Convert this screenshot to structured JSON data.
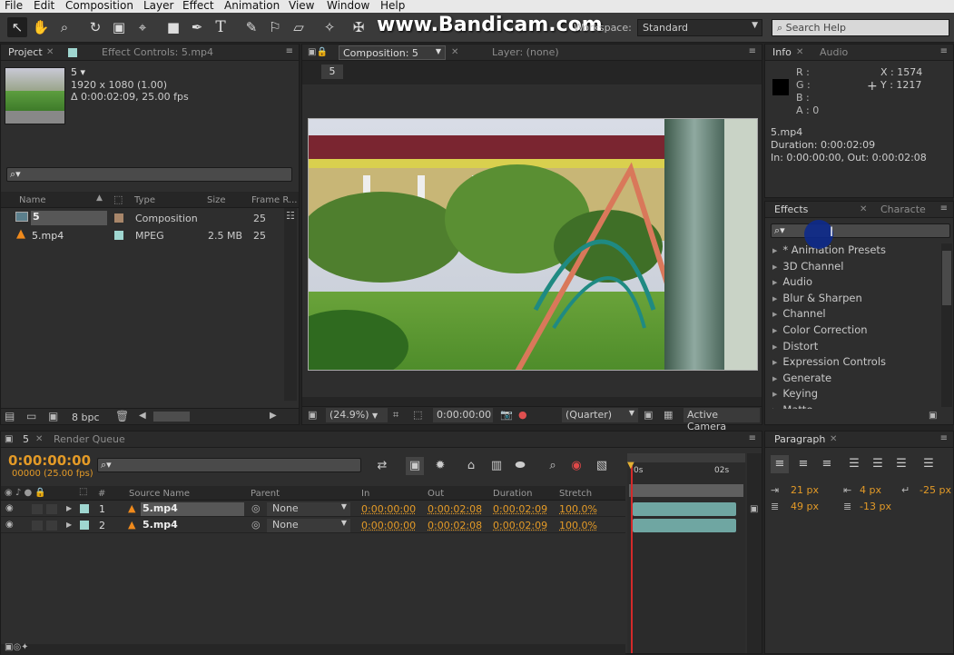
{
  "menu": [
    "File",
    "Edit",
    "Composition",
    "Layer",
    "Effect",
    "Animation",
    "View",
    "Window",
    "Help"
  ],
  "watermark": "www.Bandicam.com",
  "workspace": {
    "label": "Workspace:",
    "value": "Standard",
    "search_placeholder": "Search Help"
  },
  "project": {
    "tab_project": "Project",
    "tab_effect_controls": "Effect Controls: 5.mp4",
    "comp_name": "5 ▾",
    "comp_res": "1920 x 1080 (1.00)",
    "comp_dur": "Δ 0:00:02:09, 25.00 fps",
    "columns": [
      "Name",
      "Type",
      "Size",
      "Frame R..."
    ],
    "items": [
      {
        "name": "5",
        "type": "Composition",
        "size": "",
        "fps": "25",
        "color": "#a8866a"
      },
      {
        "name": "5.mp4",
        "type": "MPEG",
        "size": "2.5 MB",
        "fps": "25",
        "color": "#9fd6d0"
      }
    ],
    "bpc": "8 bpc"
  },
  "composition": {
    "tab_label": "Composition: 5",
    "layer_label": "Layer: (none)",
    "breadcrumb": "5",
    "zoom": "(24.9%)",
    "time": "0:00:00:00",
    "resolution": "(Quarter)",
    "camera": "Active Camera"
  },
  "info": {
    "tab_info": "Info",
    "tab_audio": "Audio",
    "r": "R :",
    "g": "G :",
    "b": "B :",
    "a": "A : 0",
    "x": "X : 1574",
    "y": "Y : 1217",
    "file": "5.mp4",
    "duration": "Duration: 0:00:02:09",
    "inout": "In: 0:00:00:00, Out: 0:00:02:08"
  },
  "effects": {
    "tab_effects": "Effects",
    "tab_character": "Characte",
    "items": [
      "* Animation Presets",
      "3D Channel",
      "Audio",
      "Blur & Sharpen",
      "Channel",
      "Color Correction",
      "Distort",
      "Expression Controls",
      "Generate",
      "Keying",
      "Matte"
    ]
  },
  "timeline": {
    "tab_comp": "5",
    "tab_render": "Render Queue",
    "timecode": "0:00:00:00",
    "frames": "00000 (25.00 fps)",
    "columns": [
      "#",
      "Source Name",
      "Parent",
      "In",
      "Out",
      "Duration",
      "Stretch"
    ],
    "layers": [
      {
        "num": "1",
        "name": "5.mp4",
        "parent": "None",
        "in": "0:00:00:00",
        "out": "0:00:02:08",
        "dur": "0:00:02:09",
        "stretch": "100.0%"
      },
      {
        "num": "2",
        "name": "5.mp4",
        "parent": "None",
        "in": "0:00:00:00",
        "out": "0:00:02:08",
        "dur": "0:00:02:09",
        "stretch": "100.0%"
      }
    ],
    "ruler_start": "0s",
    "ruler_end": "02s"
  },
  "paragraph": {
    "tab": "Paragraph",
    "indent_left": "21 px",
    "indent_right": "4 px",
    "first_line": "-25 px",
    "space_before": "49 px",
    "space_after": "-13 px"
  },
  "colors": {
    "accent": "#e39a27",
    "panel": "#2e2e2e",
    "layer_teal": "#6fa6a2"
  }
}
